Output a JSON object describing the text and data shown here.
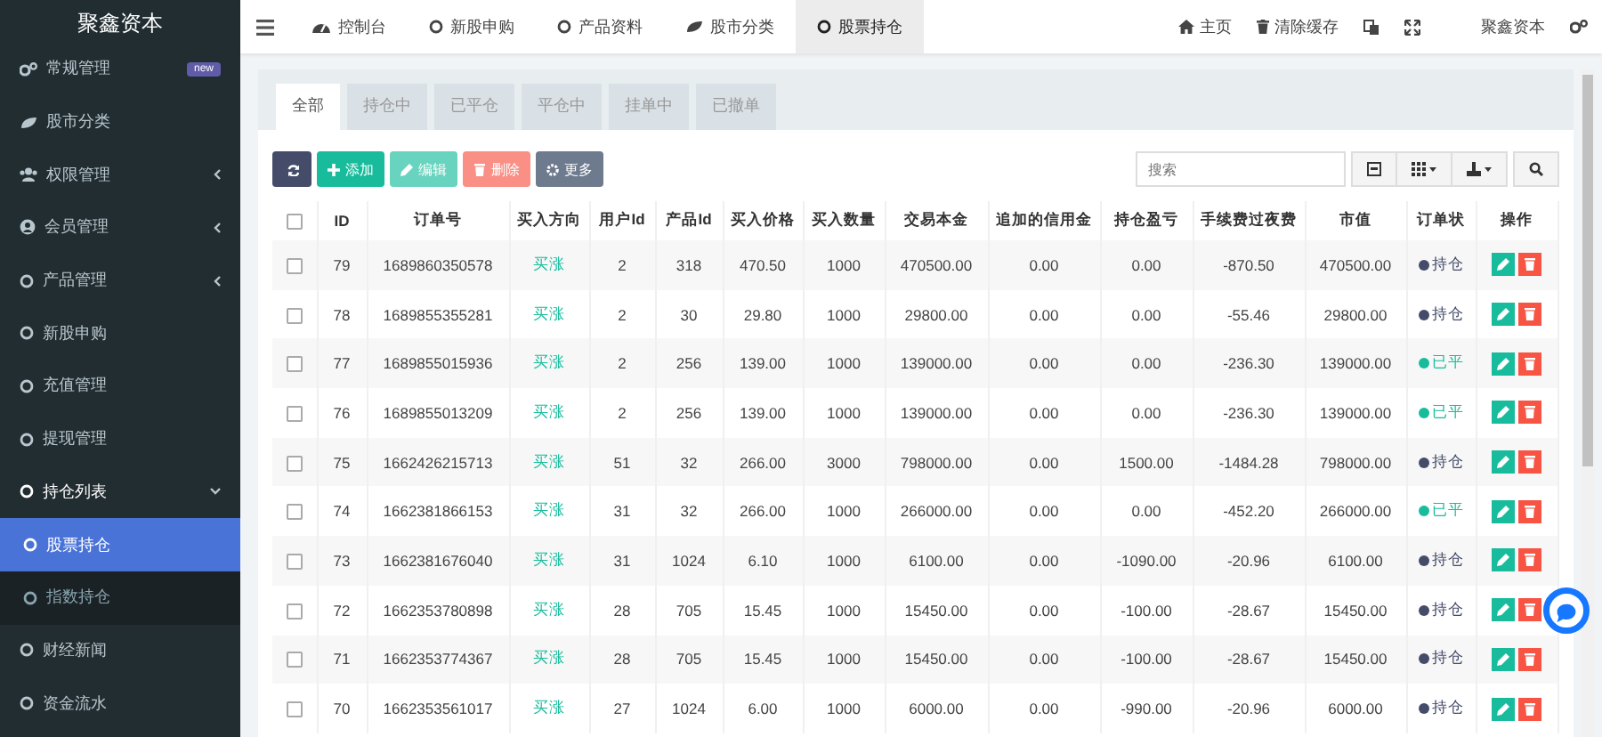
{
  "sidebar": {
    "logo": "聚鑫资本",
    "items": [
      {
        "label": "常规管理",
        "badge": "new"
      },
      {
        "label": "股市分类"
      },
      {
        "label": "权限管理",
        "expanded": false
      },
      {
        "label": "会员管理",
        "expanded": false
      },
      {
        "label": "产品管理",
        "expanded": false
      },
      {
        "label": "新股申购"
      },
      {
        "label": "充值管理"
      },
      {
        "label": "提现管理"
      },
      {
        "label": "持仓列表",
        "expanded": true,
        "children": [
          {
            "label": "股票持仓",
            "selected": true
          },
          {
            "label": "指数持仓",
            "selected": false
          }
        ]
      },
      {
        "label": "财经新闻"
      },
      {
        "label": "资金流水"
      }
    ]
  },
  "nav_tabs": [
    {
      "label": "控制台",
      "selected": false
    },
    {
      "label": "新股申购",
      "selected": false
    },
    {
      "label": "产品资料",
      "selected": false
    },
    {
      "label": "股市分类",
      "selected": false
    },
    {
      "label": "股票持仓",
      "selected": true
    }
  ],
  "nav_right": [
    {
      "kind": "link",
      "label": "主页"
    },
    {
      "kind": "link",
      "label": "清除缓存"
    },
    {
      "kind": "icon"
    },
    {
      "kind": "icon"
    },
    {
      "kind": "link",
      "label": "聚鑫资本"
    },
    {
      "kind": "icon"
    }
  ],
  "filter_tabs": [
    {
      "label": "全部",
      "selected": true
    },
    {
      "label": "持仓中",
      "selected": false
    },
    {
      "label": "已平仓",
      "selected": false
    },
    {
      "label": "平仓中",
      "selected": false
    },
    {
      "label": "挂单中",
      "selected": false
    },
    {
      "label": "已撤单",
      "selected": false
    }
  ],
  "toolbar": [
    {
      "kind": "refresh",
      "disabled": false
    },
    {
      "kind": "add",
      "label": "添加",
      "disabled": false
    },
    {
      "kind": "edit",
      "label": "编辑",
      "disabled": true
    },
    {
      "kind": "delete",
      "label": "删除",
      "disabled": true
    },
    {
      "kind": "more",
      "label": "更多",
      "disabled": false
    }
  ],
  "search": {
    "placeholder": "搜索"
  },
  "table": {
    "all_checked": false,
    "columns": [
      "ID",
      "订单号",
      "买入方向",
      "用户Id",
      "产品Id",
      "买入价格",
      "买入数量",
      "交易本金",
      "追加的信用金",
      "持仓盈亏",
      "手续费过夜费",
      "市值",
      "订单状",
      "操作"
    ],
    "rows": [
      {
        "checked": false,
        "cells": [
          "79",
          "1689860350578",
          "买涨",
          "2",
          "318",
          "470.50",
          "1000",
          "470500.00",
          "0.00",
          "0.00",
          "-870.50",
          "470500.00"
        ],
        "status": "持仓",
        "color": "#444c69"
      },
      {
        "checked": false,
        "cells": [
          "78",
          "1689855355281",
          "买涨",
          "2",
          "30",
          "29.80",
          "1000",
          "29800.00",
          "0.00",
          "0.00",
          "-55.46",
          "29800.00"
        ],
        "status": "持仓",
        "color": "#444c69"
      },
      {
        "checked": false,
        "cells": [
          "77",
          "1689855015936",
          "买涨",
          "2",
          "256",
          "139.00",
          "1000",
          "139000.00",
          "0.00",
          "0.00",
          "-236.30",
          "139000.00"
        ],
        "status": "已平",
        "color": "#18bc9c"
      },
      {
        "checked": false,
        "cells": [
          "76",
          "1689855013209",
          "买涨",
          "2",
          "256",
          "139.00",
          "1000",
          "139000.00",
          "0.00",
          "0.00",
          "-236.30",
          "139000.00"
        ],
        "status": "已平",
        "color": "#18bc9c"
      },
      {
        "checked": false,
        "cells": [
          "75",
          "1662426215713",
          "买涨",
          "51",
          "32",
          "266.00",
          "3000",
          "798000.00",
          "0.00",
          "1500.00",
          "-1484.28",
          "798000.00"
        ],
        "status": "持仓",
        "color": "#444c69"
      },
      {
        "checked": false,
        "cells": [
          "74",
          "1662381866153",
          "买涨",
          "31",
          "32",
          "266.00",
          "1000",
          "266000.00",
          "0.00",
          "0.00",
          "-452.20",
          "266000.00"
        ],
        "status": "已平",
        "color": "#18bc9c"
      },
      {
        "checked": false,
        "cells": [
          "73",
          "1662381676040",
          "买涨",
          "31",
          "1024",
          "6.10",
          "1000",
          "6100.00",
          "0.00",
          "-1090.00",
          "-20.96",
          "6100.00"
        ],
        "status": "持仓",
        "color": "#444c69"
      },
      {
        "checked": false,
        "cells": [
          "72",
          "1662353780898",
          "买涨",
          "28",
          "705",
          "15.45",
          "1000",
          "15450.00",
          "0.00",
          "-100.00",
          "-28.67",
          "15450.00"
        ],
        "status": "持仓",
        "color": "#444c69"
      },
      {
        "checked": false,
        "cells": [
          "71",
          "1662353774367",
          "买涨",
          "28",
          "705",
          "15.45",
          "1000",
          "15450.00",
          "0.00",
          "-100.00",
          "-28.67",
          "15450.00"
        ],
        "status": "持仓",
        "color": "#444c69"
      },
      {
        "checked": false,
        "cells": [
          "70",
          "1662353561017",
          "买涨",
          "27",
          "1024",
          "6.00",
          "1000",
          "6000.00",
          "0.00",
          "-990.00",
          "-20.96",
          "6000.00"
        ],
        "status": "持仓",
        "color": "#444c69"
      }
    ]
  }
}
